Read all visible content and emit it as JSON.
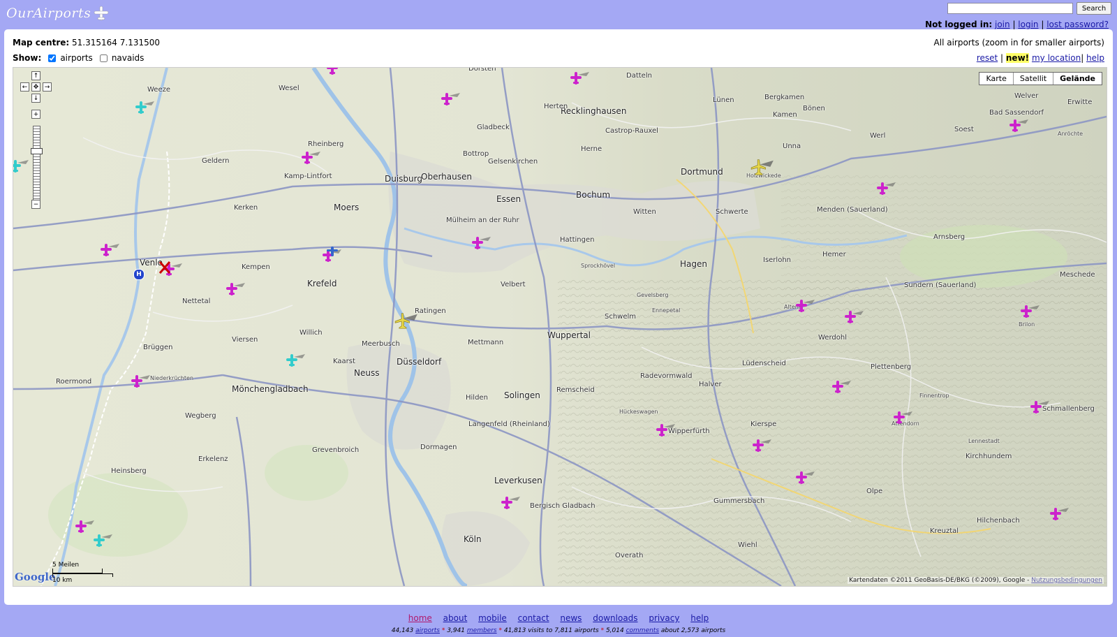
{
  "site": {
    "logo_text": "OurAirports"
  },
  "search": {
    "placeholder": "",
    "button": "Search"
  },
  "account": {
    "prefix": "Not logged in:",
    "join": "join",
    "login": "login",
    "lost_password": "lost password?"
  },
  "map_centre": {
    "label": "Map centre:",
    "value": "51.315164 7.131500"
  },
  "show": {
    "label": "Show:",
    "airports": "airports",
    "navaids": "navaids",
    "airports_checked": true,
    "navaids_checked": false
  },
  "zoom_note": "All airports (zoom in for smaller airports)",
  "map_links": {
    "reset": "reset",
    "new": "new!",
    "my_location": "my location",
    "help": "help"
  },
  "map_type": {
    "karte": "Karte",
    "satellit": "Satellit",
    "gelaende": "Gelände",
    "active": "Gelände"
  },
  "scale": {
    "miles": "5 Meilen",
    "km": "10 km"
  },
  "google": "Google",
  "copyright": {
    "text": "Kartendaten ©2011 GeoBasis-DE/BKG (©2009), Google -",
    "link": "Nutzungsbedingungen"
  },
  "places": [
    {
      "name": "Dorsten",
      "size": "normal"
    },
    {
      "name": "Datteln",
      "size": "normal"
    },
    {
      "name": "Recklinghausen",
      "size": "big"
    },
    {
      "name": "Herne",
      "size": "normal"
    },
    {
      "name": "Gelsenkirchen",
      "size": "normal"
    },
    {
      "name": "Bottrop",
      "size": "normal"
    },
    {
      "name": "Gladbeck",
      "size": "normal"
    },
    {
      "name": "Herten",
      "size": "normal"
    },
    {
      "name": "Castrop-Rauxel",
      "size": "normal"
    },
    {
      "name": "Lünen",
      "size": "normal"
    },
    {
      "name": "Bergkamen",
      "size": "normal"
    },
    {
      "name": "Kamen",
      "size": "normal"
    },
    {
      "name": "Unna",
      "size": "normal"
    },
    {
      "name": "Dortmund",
      "size": "big"
    },
    {
      "name": "Holzwickede",
      "size": "small"
    },
    {
      "name": "Bönen",
      "size": "normal"
    },
    {
      "name": "Werl",
      "size": "normal"
    },
    {
      "name": "Soest",
      "size": "normal"
    },
    {
      "name": "Bad Sassendorf",
      "size": "normal"
    },
    {
      "name": "Erwitte",
      "size": "normal"
    },
    {
      "name": "Welver",
      "size": "normal"
    },
    {
      "name": "Anröchte",
      "size": "small"
    },
    {
      "name": "Duisburg",
      "size": "big"
    },
    {
      "name": "Oberhausen",
      "size": "big"
    },
    {
      "name": "Essen",
      "size": "big"
    },
    {
      "name": "Bochum",
      "size": "big"
    },
    {
      "name": "Witten",
      "size": "normal"
    },
    {
      "name": "Schwerte",
      "size": "normal"
    },
    {
      "name": "Hagen",
      "size": "big"
    },
    {
      "name": "Iserlohn",
      "size": "normal"
    },
    {
      "name": "Hemer",
      "size": "normal"
    },
    {
      "name": "Menden (Sauerland)",
      "size": "normal"
    },
    {
      "name": "Arnsberg",
      "size": "normal"
    },
    {
      "name": "Mülheim an der Ruhr",
      "size": "normal"
    },
    {
      "name": "Moers",
      "size": "big"
    },
    {
      "name": "Krefeld",
      "size": "big"
    },
    {
      "name": "Ratingen",
      "size": "normal"
    },
    {
      "name": "Velbert",
      "size": "normal"
    },
    {
      "name": "Hattingen",
      "size": "normal"
    },
    {
      "name": "Sprockhövel",
      "size": "small"
    },
    {
      "name": "Wuppertal",
      "size": "big"
    },
    {
      "name": "Schwelm",
      "size": "normal"
    },
    {
      "name": "Mettmann",
      "size": "normal"
    },
    {
      "name": "Düsseldorf",
      "size": "big"
    },
    {
      "name": "Neuss",
      "size": "big"
    },
    {
      "name": "Solingen",
      "size": "big"
    },
    {
      "name": "Remscheid",
      "size": "normal"
    },
    {
      "name": "Lüdenscheid",
      "size": "normal"
    },
    {
      "name": "Halver",
      "size": "normal"
    },
    {
      "name": "Plettenberg",
      "size": "normal"
    },
    {
      "name": "Werdohl",
      "size": "normal"
    },
    {
      "name": "Altena",
      "size": "small"
    },
    {
      "name": "Sundern (Sauerland)",
      "size": "normal"
    },
    {
      "name": "Meschede",
      "size": "normal"
    },
    {
      "name": "Venlo",
      "size": "big"
    },
    {
      "name": "Kempen",
      "size": "normal"
    },
    {
      "name": "Viersen",
      "size": "normal"
    },
    {
      "name": "Mönchengladbach",
      "size": "big"
    },
    {
      "name": "Roermond",
      "size": "normal"
    },
    {
      "name": "Nettetal",
      "size": "normal"
    },
    {
      "name": "Geldern",
      "size": "normal"
    },
    {
      "name": "Kamp-Lintfort",
      "size": "normal"
    },
    {
      "name": "Rheinberg",
      "size": "normal"
    },
    {
      "name": "Wesel",
      "size": "normal"
    },
    {
      "name": "Weeze",
      "size": "normal"
    },
    {
      "name": "Grevenbroich",
      "size": "normal"
    },
    {
      "name": "Dormagen",
      "size": "normal"
    },
    {
      "name": "Leverkusen",
      "size": "big"
    },
    {
      "name": "Köln",
      "size": "big"
    },
    {
      "name": "Bergisch Gladbach",
      "size": "normal"
    },
    {
      "name": "Gummersbach",
      "size": "normal"
    },
    {
      "name": "Wipperfürth",
      "size": "normal"
    },
    {
      "name": "Olpe",
      "size": "normal"
    },
    {
      "name": "Attendorn",
      "size": "small"
    },
    {
      "name": "Schmallenberg",
      "size": "normal"
    },
    {
      "name": "Kirchhundem",
      "size": "normal"
    },
    {
      "name": "Erkelenz",
      "size": "normal"
    },
    {
      "name": "Heinsberg",
      "size": "normal"
    },
    {
      "name": "Langenfeld (Rheinland)",
      "size": "normal"
    },
    {
      "name": "Hilden",
      "size": "normal"
    },
    {
      "name": "Kreuztal",
      "size": "normal"
    },
    {
      "name": "Hilchenbach",
      "size": "normal"
    },
    {
      "name": "Kerken",
      "size": "normal"
    },
    {
      "name": "Willich",
      "size": "normal"
    },
    {
      "name": "Kaarst",
      "size": "normal"
    },
    {
      "name": "Meerbusch",
      "size": "normal"
    },
    {
      "name": "Brüggen",
      "size": "normal"
    },
    {
      "name": "Niederkrüchten",
      "size": "small"
    },
    {
      "name": "Wegberg",
      "size": "normal"
    },
    {
      "name": "Hückeswagen",
      "size": "small"
    },
    {
      "name": "Radevormwald",
      "size": "normal"
    },
    {
      "name": "Ennepetal",
      "size": "small"
    },
    {
      "name": "Gevelsberg",
      "size": "small"
    },
    {
      "name": "Overath",
      "size": "normal"
    },
    {
      "name": "Wiehl",
      "size": "normal"
    },
    {
      "name": "Kierspe",
      "size": "normal"
    },
    {
      "name": "Finnentrop",
      "size": "small"
    },
    {
      "name": "Lennestadt",
      "size": "small"
    },
    {
      "name": "Brilon",
      "size": "small"
    }
  ],
  "footer": {
    "links": [
      {
        "label": "home",
        "current": true
      },
      {
        "label": "about",
        "current": false
      },
      {
        "label": "mobile",
        "current": false
      },
      {
        "label": "contact",
        "current": false
      },
      {
        "label": "news",
        "current": false
      },
      {
        "label": "downloads",
        "current": false
      },
      {
        "label": "privacy",
        "current": false
      },
      {
        "label": "help",
        "current": false
      }
    ],
    "stats": {
      "airports_count": "44,143",
      "airports_label": "airports",
      "members_count": "3,941",
      "members_label": "members",
      "visits": "41,813 visits to 7,811 airports",
      "comments_count": "5,014",
      "comments_label": "comments",
      "comments_suffix": "about 2,573 airports"
    }
  },
  "colors": {
    "background": "#a4a8f4",
    "airport_marker": "#cc22cc",
    "heliport_marker": "#33cccc",
    "large_airport_marker": "#e8d84a",
    "closed_marker": "#cc0000"
  },
  "icons": [
    "plane-logo-icon",
    "airport-marker-icon",
    "heliport-marker-icon",
    "large-airport-marker-icon",
    "closed-airport-icon",
    "pan-up-icon",
    "pan-down-icon",
    "pan-left-icon",
    "pan-right-icon",
    "zoom-in-icon",
    "zoom-out-icon"
  ]
}
